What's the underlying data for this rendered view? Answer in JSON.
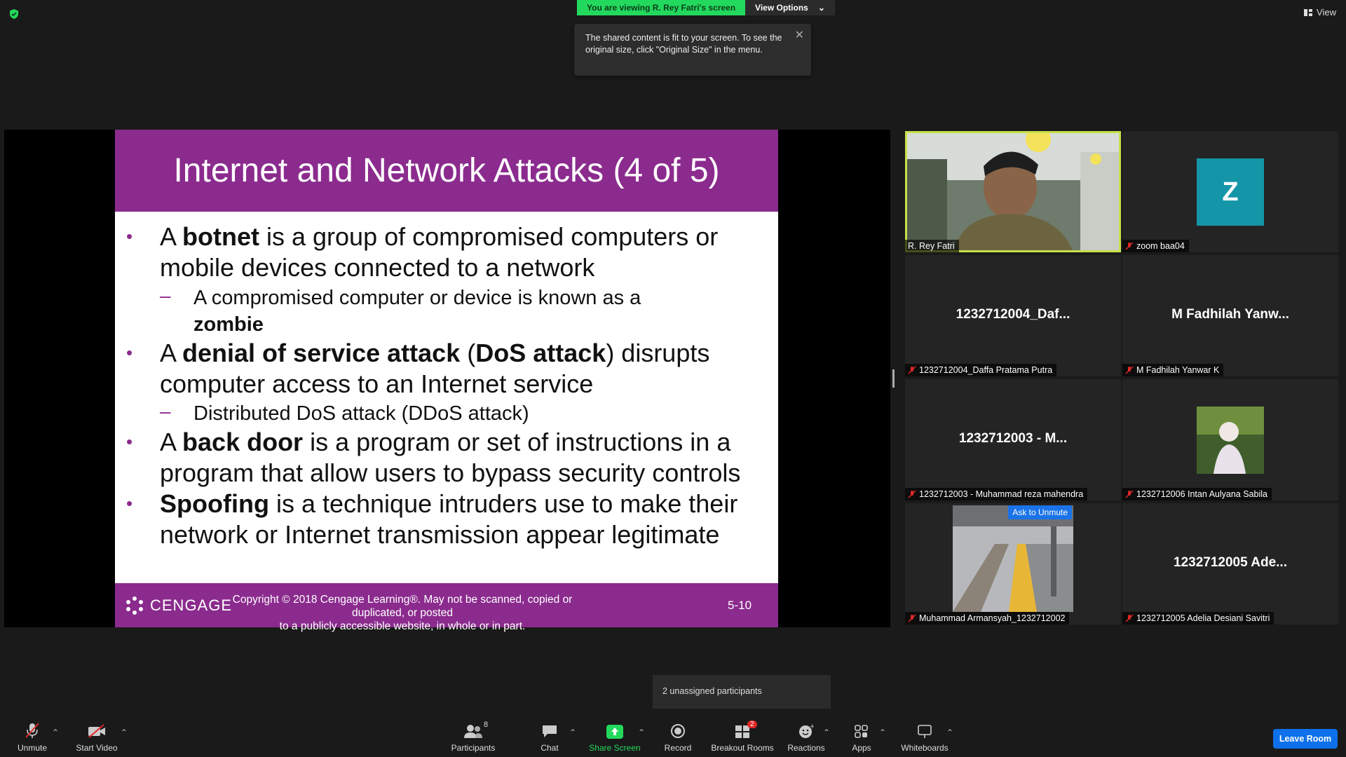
{
  "top": {
    "viewing_banner": "You are viewing R. Rey Fatri's screen",
    "view_options": "View Options",
    "view_label": "View",
    "tooltip_text": "The shared content is fit to your screen. To see the original size, click \"Original Size\" in the menu."
  },
  "slide": {
    "title": "Internet and Network Attacks (4 of 5)",
    "b1_pre": "A ",
    "b1_bold": "botnet",
    "b1_post": " is a group of compromised computers or",
    "b1_line2": "mobile devices connected to a network",
    "s1_line1": "A compromised computer or device is known as a",
    "s1_bold": "zombie",
    "b2_pre": "A ",
    "b2_bold1": "denial of service attack",
    "b2_mid": " (",
    "b2_bold2": "DoS attack",
    "b2_post": ") disrupts",
    "b2_line2": "computer access to an Internet service",
    "s2_line1": "Distributed DoS  attack (DDoS attack)",
    "b3_pre": "A ",
    "b3_bold": "back door",
    "b3_post": " is a program or set of instructions in a",
    "b3_line2": "program that allow users to bypass security controls",
    "b4_bold": "Spoofing",
    "b4_post": " is a technique intruders use to make their",
    "b4_line2": "network or Internet transmission appear legitimate",
    "footer_brand": "CENGAGE",
    "footer_copyright_1": "Copyright © 2018 Cengage Learning®. May not be scanned, copied or duplicated, or posted",
    "footer_copyright_2": "to a publicly accessible website, in whole or in part.",
    "page_number": "5-10"
  },
  "gallery": {
    "t1_name": "R. Rey Fatri",
    "t2_initial": "Z",
    "t2_name": "zoom baa04",
    "t3_big": "1232712004_Daf...",
    "t3_name": "1232712004_Daffa Pratama Putra",
    "t4_big": "M Fadhilah Yanw...",
    "t4_name": "M Fadhilah Yanwar K",
    "t5_big": "1232712003 - M...",
    "t5_name": "1232712003 - Muhammad reza mahendra",
    "t6_name": "1232712006 Intan Aulyana Sabila",
    "t7_badge": "Ask to Unmute",
    "t7_name": "Muhammad Armansyah_1232712002",
    "t8_big": "1232712005 Ade...",
    "t8_name": "1232712005 Adelia Desiani Savitri"
  },
  "popover": {
    "text": "2 unassigned participants"
  },
  "toolbar": {
    "unmute": "Unmute",
    "start_video": "Start Video",
    "participants": "Participants",
    "participants_count": "8",
    "chat": "Chat",
    "share_screen": "Share Screen",
    "record": "Record",
    "breakout_rooms": "Breakout Rooms",
    "breakout_badge": "2",
    "reactions": "Reactions",
    "apps": "Apps",
    "whiteboards": "Whiteboards",
    "leave_room": "Leave Room"
  },
  "colors": {
    "slide_purple": "#8b2b8e",
    "share_green": "#23d95d",
    "active_speaker": "#c8e04a",
    "leave_blue": "#0e71eb",
    "mic_muted_red": "#e02828"
  }
}
